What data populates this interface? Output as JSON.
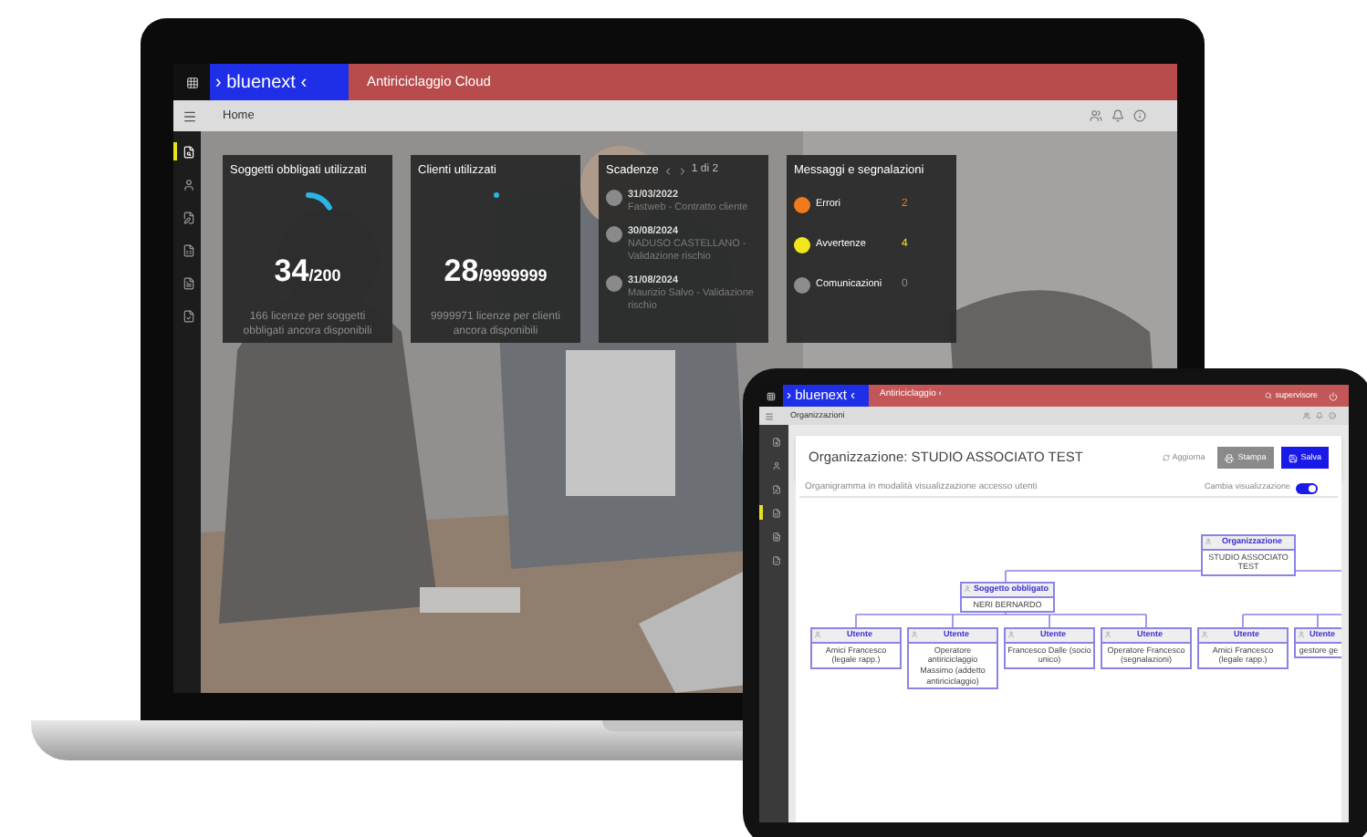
{
  "laptop": {
    "logo": "› bluenext ‹",
    "app_title": "Antiriciclaggio Cloud",
    "breadcrumb": "Home",
    "sidebar": [
      {
        "selected": true
      },
      {
        "selected": false
      },
      {
        "selected": false
      },
      {
        "selected": false
      },
      {
        "selected": false
      },
      {
        "selected": false
      }
    ],
    "cards": [
      {
        "kind": "gauge",
        "title": "Soggetti obbligati utilizzati",
        "level": 0.17,
        "value": "34",
        "total": "/200",
        "note": "166 licenze per soggetti obbligati ancora disponibili"
      },
      {
        "kind": "gauge",
        "title": "Clienti utilizzati",
        "level": 3e-06,
        "value": "28",
        "total": "/9999999",
        "note": "9999971 licenze per clienti ancora disponibili"
      },
      {
        "kind": "deadlines",
        "title": "Scadenze",
        "pager": "1 di 2",
        "items": [
          {
            "date": "31/03/2022",
            "text": "Fastweb - Contratto cliente"
          },
          {
            "date": "30/08/2024",
            "text": "NADUSO CASTELLANO - Validazione rischio"
          },
          {
            "date": "31/08/2024",
            "text": "Maurizio Salvo - Validazione rischio"
          }
        ]
      },
      {
        "kind": "messages",
        "title": "Messaggi e segnalazioni",
        "items": [
          {
            "label": "Errori",
            "count": "2",
            "color": "#f07a1c"
          },
          {
            "label": "Avvertenze",
            "count": "4",
            "color": "#f2e51b"
          },
          {
            "label": "Comunicazioni",
            "count": "0",
            "color": "#8c8c8c"
          }
        ]
      }
    ]
  },
  "tablet": {
    "logo": "› bluenext ‹",
    "app_title": "Antiriciclaggio ‹",
    "user": "supervisore",
    "breadcrumb": "Organizzazioni",
    "sidebar": [
      {
        "selected": false
      },
      {
        "selected": false
      },
      {
        "selected": false
      },
      {
        "selected": true
      },
      {
        "selected": false
      },
      {
        "selected": false
      }
    ],
    "title": "Organizzazione: STUDIO ASSOCIATO TEST",
    "buttons": [
      {
        "kind": "link",
        "label": "Aggiorna"
      },
      {
        "kind": "secondary",
        "label": "Stampa"
      },
      {
        "kind": "primary",
        "label": "Salva"
      }
    ],
    "subtitle": "Organigramma in modalità visualizzazione accesso utenti",
    "toggle": {
      "label": "Cambia visualizzazione",
      "on": true
    },
    "org_chart": {
      "root": {
        "role": "Organizzazione",
        "name": "STUDIO ASSOCIATO TEST"
      },
      "obligated": {
        "role": "Soggetto obbligato",
        "name": "NERI BERNARDO"
      },
      "users": [
        {
          "role": "Utente",
          "name": "Amici Francesco (legale rapp.)"
        },
        {
          "role": "Utente",
          "name": "Operatore antiriciclaggio Massimo (addetto antiriciclaggio)"
        },
        {
          "role": "Utente",
          "name": "Francesco Dalle (socio unico)"
        },
        {
          "role": "Utente",
          "name": "Operatore Francesco (segnalazioni)"
        },
        {
          "role": "Utente",
          "name": "Amici Francesco (legale rapp.)"
        },
        {
          "role": "Utente",
          "name": "gestore ge"
        }
      ]
    }
  }
}
